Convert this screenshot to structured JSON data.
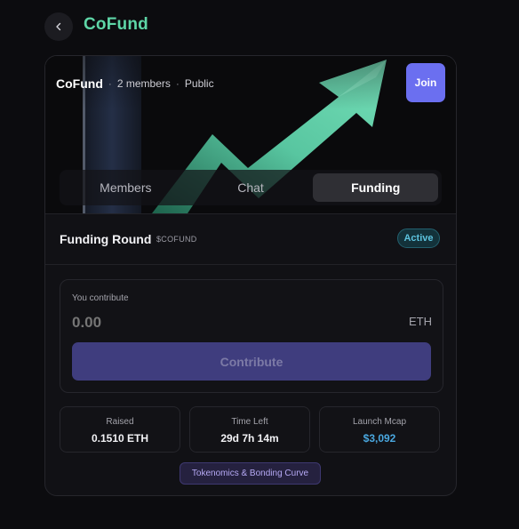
{
  "header": {
    "title": "CoFund",
    "back_icon": "chevron-left-icon"
  },
  "hero": {
    "name": "CoFund",
    "members": "2 members",
    "visibility": "Public",
    "separator": "·",
    "join_label": "Join",
    "image": "green-arrow-chart-image"
  },
  "tabs": [
    {
      "label": "Members",
      "active": false
    },
    {
      "label": "Chat",
      "active": false
    },
    {
      "label": "Funding",
      "active": true
    }
  ],
  "funding": {
    "title": "Funding Round",
    "ticker": "$COFUND",
    "status": "Active",
    "contribute_label": "You contribute",
    "amount_placeholder": "0.00",
    "currency": "ETH",
    "contribute_button": "Contribute"
  },
  "stats": [
    {
      "label": "Raised",
      "value": "0.1510 ETH"
    },
    {
      "label": "Time Left",
      "value": "29d 7h 14m"
    },
    {
      "label": "Launch Mcap",
      "value": "$3,092"
    }
  ],
  "tokenomics_button": "Tokenomics & Bonding Curve",
  "colors": {
    "background": "#0c0c0f",
    "brand_green": "#5ed6a7",
    "join_purple": "#6b6ff0",
    "active_badge": "#5cc2dd",
    "mcap_blue": "#4aa8e0"
  }
}
